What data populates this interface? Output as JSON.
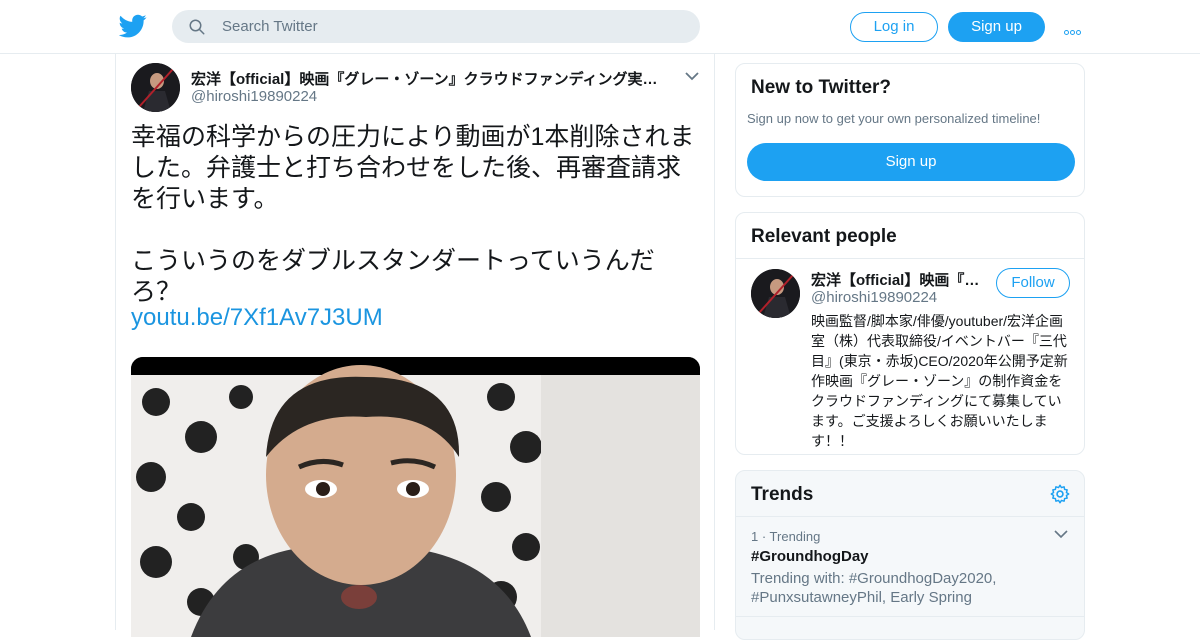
{
  "header": {
    "logo_icon": "twitter-bird-icon",
    "search_placeholder": "Search Twitter",
    "login_label": "Log in",
    "signup_label": "Sign up",
    "more_icon": "more-dots-icon"
  },
  "tweet": {
    "display_name": "宏洋【official】映画『グレー・ゾーン』クラウドファンディング実施中",
    "handle": "@hiroshi19890224",
    "text": "幸福の科学からの圧力により動画が1本削除されました。弁護士と打ち合わせをした後、再審査請求を行います。\n\nこういうのをダブルスタンダートっていうんだろ？",
    "link": "youtu.be/7Xf1Av7J3UM"
  },
  "new_to_twitter": {
    "title": "New to Twitter?",
    "subtitle": "Sign up now to get your own personalized timeline!",
    "button_label": "Sign up"
  },
  "relevant_people": {
    "title": "Relevant people",
    "name": "宏洋【official】映画『グレー・ゾーン』",
    "handle": "@hiroshi19890224",
    "follow_label": "Follow",
    "bio": "映画監督/脚本家/俳優/youtuber/宏洋企画室（株）代表取締役/イベントバー『三代目』(東京・赤坂)CEO/2020年公開予定新作映画『グレー・ゾーン』の制作資金をクラウドファンディングにて募集しています。ご支援よろしくお願いいたします！！"
  },
  "trends": {
    "title": "Trends",
    "items": [
      {
        "meta": "1 · Trending",
        "name": "#GroundhogDay",
        "with": "Trending with: #GroundhogDay2020, #PunxsutawneyPhil, Early Spring"
      }
    ]
  },
  "colors": {
    "accent": "#1da1f2",
    "link": "#1b95e0",
    "text": "#14171a",
    "muted": "#657786",
    "border": "#e6ecf0"
  }
}
